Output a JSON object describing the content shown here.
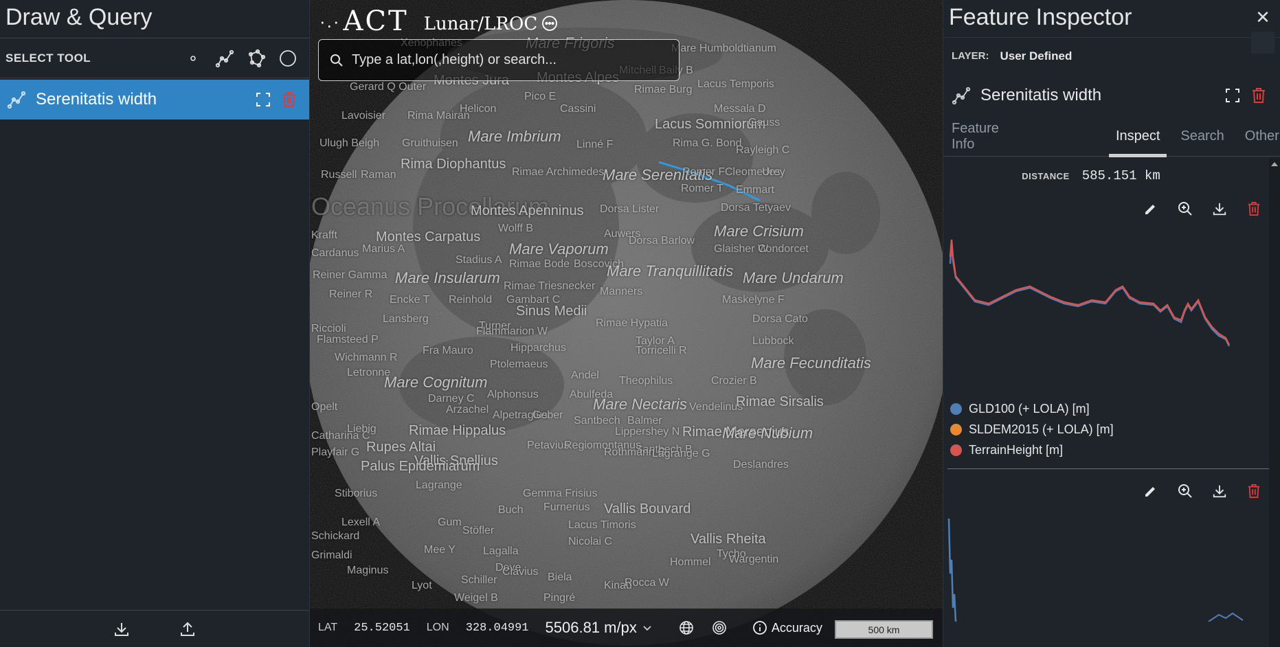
{
  "left_panel": {
    "title": "Draw & Query",
    "select_tool_label": "SELECT TOOL",
    "feature_name": "Serenitatis width"
  },
  "map": {
    "brand": {
      "logo_dots": "·.·",
      "logo_text": "ACT",
      "mission": "Lunar/LROC"
    },
    "search_placeholder": "Type a lat,lon(,height) or search...",
    "labels": [
      {
        "t": "Xenophanes",
        "s": "s"
      },
      {
        "t": "Mare Frigoris",
        "s": "big"
      },
      {
        "t": "Mare Humboldtianum",
        "s": "s"
      },
      {
        "t": "Montes Jura",
        "s": "mid"
      },
      {
        "t": "Montes Alpes",
        "s": "mid"
      },
      {
        "t": "Gerard Q Outer",
        "s": "s"
      },
      {
        "t": "Mitchell",
        "s": "s"
      },
      {
        "t": "Baily B",
        "s": "s"
      },
      {
        "t": "Lacus Temporis",
        "s": "s"
      },
      {
        "t": "Pico E",
        "s": "s"
      },
      {
        "t": "Rimae Burg",
        "s": "s"
      },
      {
        "t": "Lavoisier",
        "s": "s"
      },
      {
        "t": "Rima Mairan",
        "s": "s"
      },
      {
        "t": "Helicon",
        "s": "s"
      },
      {
        "t": "Cassini",
        "s": "s"
      },
      {
        "t": "Messala D",
        "s": "s"
      },
      {
        "t": "Lacus Somniorum",
        "s": "mid"
      },
      {
        "t": "Gauss",
        "s": "s"
      },
      {
        "t": "Mare Imbrium",
        "s": "big"
      },
      {
        "t": "Ulugh Beigh",
        "s": "s"
      },
      {
        "t": "Gruithuisen",
        "s": "s"
      },
      {
        "t": "Linné F",
        "s": "s"
      },
      {
        "t": "Rima G. Bond",
        "s": "s"
      },
      {
        "t": "Rayleigh C",
        "s": "s"
      },
      {
        "t": "Rima Diophantus",
        "s": "mid"
      },
      {
        "t": "Mare Serenitatis",
        "s": "big"
      },
      {
        "t": "Romer F",
        "s": "s"
      },
      {
        "t": "Cleomedes",
        "s": "s"
      },
      {
        "t": "Urey",
        "s": "s"
      },
      {
        "t": "Russell",
        "s": "s"
      },
      {
        "t": "Raman",
        "s": "s"
      },
      {
        "t": "Rimae Archimedes",
        "s": "s"
      },
      {
        "t": "Romer T",
        "s": "s"
      },
      {
        "t": "Emmart",
        "s": "s"
      },
      {
        "t": "Oceanus Procellarum",
        "s": "huge"
      },
      {
        "t": "Montes Apenninus",
        "s": "mid"
      },
      {
        "t": "Dorsa Lister",
        "s": "s"
      },
      {
        "t": "Dorsa Tetyaev",
        "s": "s"
      },
      {
        "t": "Wolff B",
        "s": "s"
      },
      {
        "t": "Mare Crisium",
        "s": "big"
      },
      {
        "t": "Krafft",
        "s": "s"
      },
      {
        "t": "Montes Carpatus",
        "s": "mid"
      },
      {
        "t": "Auwers",
        "s": "s"
      },
      {
        "t": "Dorsa Barlow",
        "s": "s"
      },
      {
        "t": "Cardanus",
        "s": "s"
      },
      {
        "t": "Marius A",
        "s": "s"
      },
      {
        "t": "Mare Vaporum",
        "s": "big"
      },
      {
        "t": "Glaisher W",
        "s": "s"
      },
      {
        "t": "Condorcet",
        "s": "s"
      },
      {
        "t": "Stadius A",
        "s": "s"
      },
      {
        "t": "Rimae Bode",
        "s": "s"
      },
      {
        "t": "Boscovich",
        "s": "s"
      },
      {
        "t": "Mare Tranquillitatis",
        "s": "big"
      },
      {
        "t": "Reiner Gamma",
        "s": "s"
      },
      {
        "t": "Mare Insularum",
        "s": "big"
      },
      {
        "t": "Mare Undarum",
        "s": "big"
      },
      {
        "t": "Rimae Triesnecker",
        "s": "s"
      },
      {
        "t": "Manners",
        "s": "s"
      },
      {
        "t": "Reiner R",
        "s": "s"
      },
      {
        "t": "Encke T",
        "s": "s"
      },
      {
        "t": "Reinhold",
        "s": "s"
      },
      {
        "t": "Gambart C",
        "s": "s"
      },
      {
        "t": "Maskelyne F",
        "s": "s"
      },
      {
        "t": "Sinus Medii",
        "s": "mid"
      },
      {
        "t": "Lansberg",
        "s": "s"
      },
      {
        "t": "Dorsa Cato",
        "s": "s"
      },
      {
        "t": "Riccioli",
        "s": "s"
      },
      {
        "t": "Turner",
        "s": "s"
      },
      {
        "t": "Rimae Hypatia",
        "s": "s"
      },
      {
        "t": "Flammarion W",
        "s": "s"
      },
      {
        "t": "Flamsteed P",
        "s": "s"
      },
      {
        "t": "Taylor A",
        "s": "s"
      },
      {
        "t": "Lubbock",
        "s": "s"
      },
      {
        "t": "Hipparchus",
        "s": "s"
      },
      {
        "t": "Torricelli R",
        "s": "s"
      },
      {
        "t": "Wichmann R",
        "s": "s"
      },
      {
        "t": "Fra Mauro",
        "s": "s"
      },
      {
        "t": "Mare Fecunditatis",
        "s": "big"
      },
      {
        "t": "Ptolemaeus",
        "s": "s"
      },
      {
        "t": "Letronne",
        "s": "s"
      },
      {
        "t": "Mare Cognitum",
        "s": "big"
      },
      {
        "t": "Andel",
        "s": "s"
      },
      {
        "t": "Theophilus",
        "s": "s"
      },
      {
        "t": "Crozier B",
        "s": "s"
      },
      {
        "t": "Alphonsus",
        "s": "s"
      },
      {
        "t": "Abulfeda",
        "s": "s"
      },
      {
        "t": "Darney C",
        "s": "s"
      },
      {
        "t": "Mare Nectaris",
        "s": "big"
      },
      {
        "t": "Vendelinus",
        "s": "s"
      },
      {
        "t": "Rimae Sirsalis",
        "s": "mid"
      },
      {
        "t": "Opelt",
        "s": "s"
      },
      {
        "t": "Arzachel",
        "s": "s"
      },
      {
        "t": "Alpetragius",
        "s": "s"
      },
      {
        "t": "Geber",
        "s": "s"
      },
      {
        "t": "Santbech",
        "s": "s"
      },
      {
        "t": "Balmer",
        "s": "s"
      },
      {
        "t": "Rimae Mersenius",
        "s": "mid"
      },
      {
        "t": "Mare Nubium",
        "s": "big"
      },
      {
        "t": "Catharina C",
        "s": "s"
      },
      {
        "t": "Liebig",
        "s": "s"
      },
      {
        "t": "Rimae Hippalus",
        "s": "mid"
      },
      {
        "t": "Lippershey N",
        "s": "s"
      },
      {
        "t": "Playfair G",
        "s": "s"
      },
      {
        "t": "Rupes Altai",
        "s": "mid"
      },
      {
        "t": "Santbech B",
        "s": "s"
      },
      {
        "t": "Petavius",
        "s": "s"
      },
      {
        "t": "Regiomontanus",
        "s": "s"
      },
      {
        "t": "Rothmann G",
        "s": "s"
      },
      {
        "t": "Lagrange G",
        "s": "s"
      },
      {
        "t": "Vallis Snellius",
        "s": "mid"
      },
      {
        "t": "Palus Epidemiarum",
        "s": "mid"
      },
      {
        "t": "Deslandres",
        "s": "s"
      },
      {
        "t": "Lagrange",
        "s": "s"
      },
      {
        "t": "Gemma Frisius",
        "s": "s"
      },
      {
        "t": "Stiborius",
        "s": "s"
      },
      {
        "t": "Furnerius",
        "s": "s"
      },
      {
        "t": "Vallis Bouvard",
        "s": "mid"
      },
      {
        "t": "Lexell A",
        "s": "s"
      },
      {
        "t": "Buch",
        "s": "s"
      },
      {
        "t": "Lacus Timoris",
        "s": "s"
      },
      {
        "t": "Gum",
        "s": "s"
      },
      {
        "t": "Stöfler",
        "s": "s"
      },
      {
        "t": "Nicolai C",
        "s": "s"
      },
      {
        "t": "Vallis Rheita",
        "s": "mid"
      },
      {
        "t": "Schickard",
        "s": "s"
      },
      {
        "t": "Mee Y",
        "s": "s"
      },
      {
        "t": "Lagalla",
        "s": "s"
      },
      {
        "t": "Tycho",
        "s": "s"
      },
      {
        "t": "Dove",
        "s": "s"
      },
      {
        "t": "Wargentin",
        "s": "s"
      },
      {
        "t": "Maginus",
        "s": "s"
      },
      {
        "t": "Clavius",
        "s": "s"
      },
      {
        "t": "Lyot",
        "s": "s"
      },
      {
        "t": "Schiller",
        "s": "s"
      },
      {
        "t": "Weigel B",
        "s": "s"
      },
      {
        "t": "Pingré",
        "s": "s"
      },
      {
        "t": "Hommel",
        "s": "s"
      },
      {
        "t": "Biela",
        "s": "s"
      },
      {
        "t": "Kinau",
        "s": "s"
      },
      {
        "t": "Rocca W",
        "s": "s"
      },
      {
        "t": "Grimaldi",
        "s": "s"
      }
    ],
    "bottom_bar": {
      "lat_label": "LAT",
      "lat_value": "25.52051",
      "lon_label": "LON",
      "lon_value": "328.04991",
      "resolution": "5506.81 m/px",
      "accuracy_label": "Accuracy",
      "scale_label": "500 km"
    }
  },
  "right_panel": {
    "title": "Feature Inspector",
    "close_glyph": "✕",
    "layer_label": "LAYER:",
    "layer_value": "User Defined",
    "feature_name": "Serenitatis width",
    "tabs": [
      "Feature Info",
      "Inspect",
      "Search",
      "Other"
    ],
    "active_tab": "Inspect",
    "distance_label": "DISTANCE",
    "distance_value": "585.151 km",
    "legend": [
      {
        "name": "GLD100 (+ LOLA) [m]",
        "color": "#4f7fb5"
      },
      {
        "name": "SLDEM2015 (+ LOLA) [m]",
        "color": "#e8892f"
      },
      {
        "name": "TerrainHeight [m]",
        "color": "#d9534f"
      }
    ]
  },
  "colors": {
    "panel_bg": "#1f242b",
    "accent_blue": "#3184c4",
    "danger_red": "#e03a3a",
    "measure_line": "#2f9be0"
  }
}
